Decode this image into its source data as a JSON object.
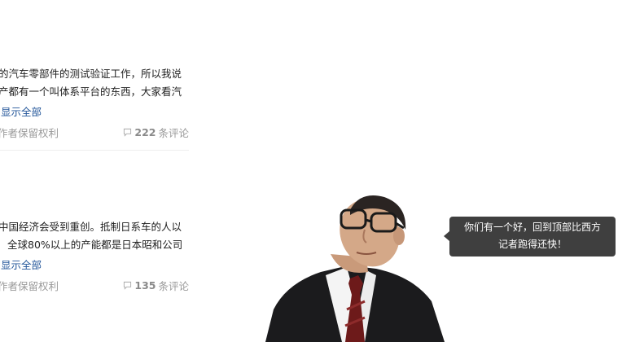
{
  "feed": {
    "items": [
      {
        "line1": "的汽车零部件的测试验证工作，所以我说",
        "line2": "产都有一个叫体系平台的东西，大家看汽",
        "expand_label": "显示全部",
        "copyright": "作者保留权利",
        "comment_count": "222",
        "comment_suffix": "条评论"
      },
      {
        "line1": "中国经济会受到重创。抵制日系车的人以",
        "line2": "全球80%以上的产能都是日本昭和公司",
        "expand_label": "显示全部",
        "copyright": "作者保留权利",
        "comment_count": "135",
        "comment_suffix": "条评论"
      }
    ]
  },
  "back_to_top": {
    "tooltip_line1": "你们有一个好，回到顶部比西方",
    "tooltip_line2": "记者跑得还快！"
  },
  "colors": {
    "link": "#225599",
    "muted": "#999999",
    "tooltip_bg": "#3f3f3f"
  }
}
